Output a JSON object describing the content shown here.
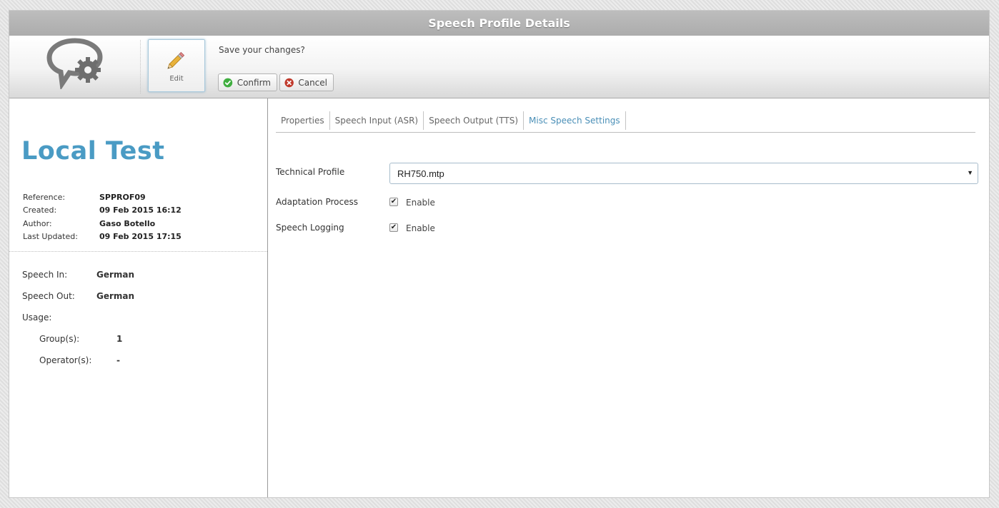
{
  "window": {
    "title": "Speech Profile Details"
  },
  "toolbar": {
    "edit_label": "Edit",
    "save_prompt": "Save your changes?",
    "confirm_label": "Confirm",
    "cancel_label": "Cancel"
  },
  "profile": {
    "name": "Local Test",
    "meta": [
      {
        "label": "Reference:",
        "value": "SPPROF09"
      },
      {
        "label": "Created:",
        "value": "09 Feb 2015 16:12"
      },
      {
        "label": "Author:",
        "value": "Gaso Botello"
      },
      {
        "label": "Last Updated:",
        "value": "09 Feb 2015 17:15"
      }
    ],
    "speech_in_label": "Speech In:",
    "speech_in": "German",
    "speech_out_label": "Speech Out:",
    "speech_out": "German",
    "usage_label": "Usage:",
    "groups_label": "Group(s):",
    "groups": "1",
    "operators_label": "Operator(s):",
    "operators": "-"
  },
  "tabs": [
    {
      "label": "Properties",
      "active": false
    },
    {
      "label": "Speech Input (ASR)",
      "active": false
    },
    {
      "label": "Speech Output (TTS)",
      "active": false
    },
    {
      "label": "Misc Speech Settings",
      "active": true
    }
  ],
  "form": {
    "technical_profile_label": "Technical Profile",
    "technical_profile_value": "RH750.mtp",
    "adaptation_label": "Adaptation Process",
    "adaptation_enabled": true,
    "adaptation_option": "Enable",
    "logging_label": "Speech Logging",
    "logging_enabled": true,
    "logging_option": "Enable"
  },
  "colors": {
    "accent": "#4a9bc4",
    "titlebar": "#b3b3b3",
    "confirm_icon": "#3fae3f",
    "cancel_icon": "#c0392b"
  },
  "icons": {
    "logo": "speech-bubble-gear-icon",
    "edit": "pencil-icon",
    "confirm": "check-circle-icon",
    "cancel": "x-circle-icon",
    "dropdown": "triangle-down-icon"
  }
}
